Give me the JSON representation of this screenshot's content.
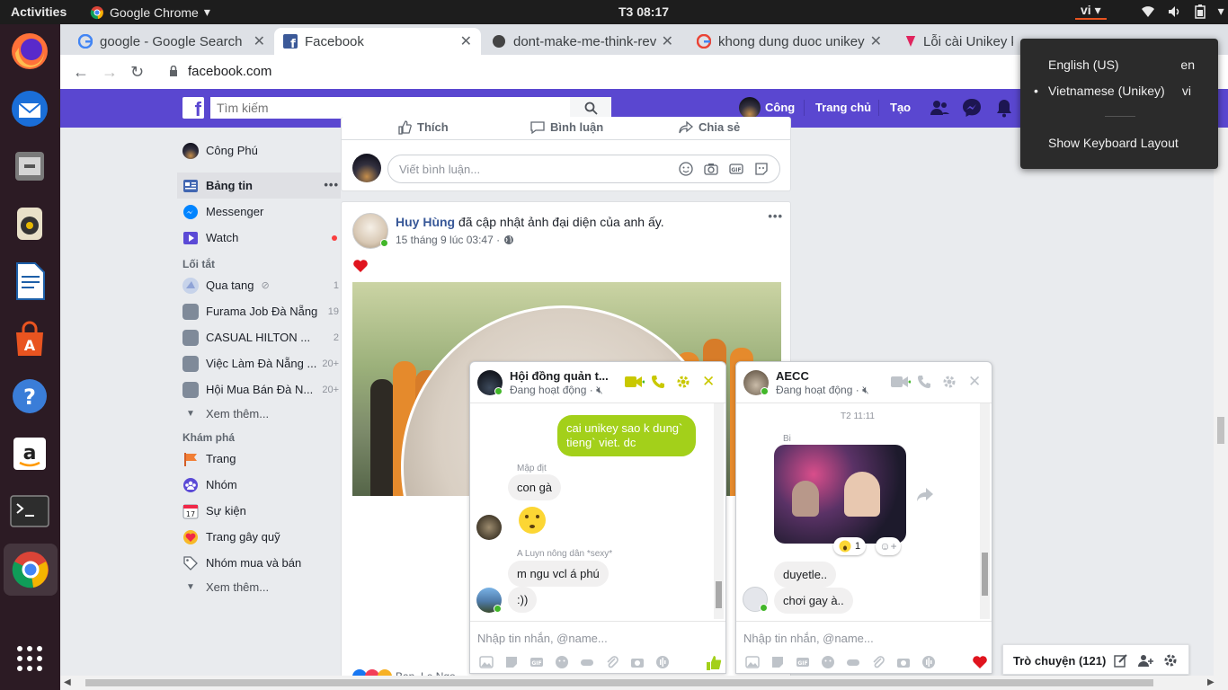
{
  "system": {
    "activities": "Activities",
    "app_name": "Google Chrome",
    "clock": "T3 08:17",
    "lang_indicator": "vi"
  },
  "lang_menu": {
    "items": [
      {
        "label": "English (US)",
        "code": "en"
      },
      {
        "label": "Vietnamese (Unikey)",
        "code": "vi",
        "selected": true
      }
    ],
    "show_layout": "Show Keyboard Layout"
  },
  "tabs": [
    {
      "title": "google - Google Search",
      "icon": "google-icon"
    },
    {
      "title": "Facebook",
      "icon": "facebook-icon",
      "active": true
    },
    {
      "title": "dont-make-me-think-rev",
      "icon": "github-icon"
    },
    {
      "title": "khong dung duoc unikey",
      "icon": "google-icon"
    },
    {
      "title": "Lỗi cài Unikey khi",
      "icon": "pin-icon"
    }
  ],
  "address": {
    "url": "facebook.com"
  },
  "fb_header": {
    "search_placeholder": "Tìm kiếm",
    "user": "Công",
    "home": "Trang chủ",
    "create": "Tạo"
  },
  "sidebar": {
    "profile": "Công Phú",
    "main": [
      {
        "label": "Bảng tin",
        "icon": "news-feed-icon"
      },
      {
        "label": "Messenger",
        "icon": "messenger-icon"
      },
      {
        "label": "Watch",
        "icon": "watch-icon"
      }
    ],
    "shortcuts_title": "Lối tắt",
    "shortcuts": [
      {
        "label": "Qua tang",
        "count": "1"
      },
      {
        "label": "Furama Job Đà Nẵng",
        "count": "19"
      },
      {
        "label": "CASUAL HILTON ...",
        "count": "2"
      },
      {
        "label": "Việc Làm Đà Nẵng ...",
        "count": "20+"
      },
      {
        "label": "Hội Mua Bán Đà N...",
        "count": "20+"
      }
    ],
    "see_more_1": "Xem thêm...",
    "explore_title": "Khám phá",
    "explore": [
      {
        "label": "Trang"
      },
      {
        "label": "Nhóm"
      },
      {
        "label": "Sự kiện"
      },
      {
        "label": "Trang gây quỹ"
      },
      {
        "label": "Nhóm mua và bán"
      }
    ],
    "see_more_2": "Xem thêm..."
  },
  "top_card": {
    "like": "Thích",
    "comment": "Bình luận",
    "share": "Chia sẻ",
    "comment_placeholder": "Viết bình luận..."
  },
  "post": {
    "author": "Huy Hùng",
    "action": "đã cập nhật ảnh đại diện của anh ấy.",
    "time": "15 tháng 9 lúc 03:47 ·",
    "reaction_line": "Bạn, Le Ngọ"
  },
  "chat1": {
    "name": "Hội đồng quản t...",
    "status": "Đang hoạt động ·",
    "my_message": "cai unikey sao k dung` tieng` viet. dc",
    "sender1": "Mập địt",
    "msg1": "con gà",
    "sender2": "A Luyn nông dân *sexy*",
    "msg2": "m ngu vcl á phú",
    "msg3": ":))",
    "input_placeholder": "Nhập tin nhắn, @name..."
  },
  "chat2": {
    "name": "AECC",
    "status": "Đang hoạt động ·",
    "date": "T2 11:11",
    "sender": "Bi",
    "reaction_count": "1",
    "msg1": "duyetle..",
    "msg2": "chơi gay à..",
    "input_placeholder": "Nhập tin nhắn, @name..."
  },
  "chatbar": {
    "label": "Trò chuyện (121)"
  },
  "colors": {
    "fb_header": "#5a47d0",
    "chat_accent": "#a3d01a",
    "online": "#42b72a",
    "ubuntu_orange": "#e95420"
  }
}
